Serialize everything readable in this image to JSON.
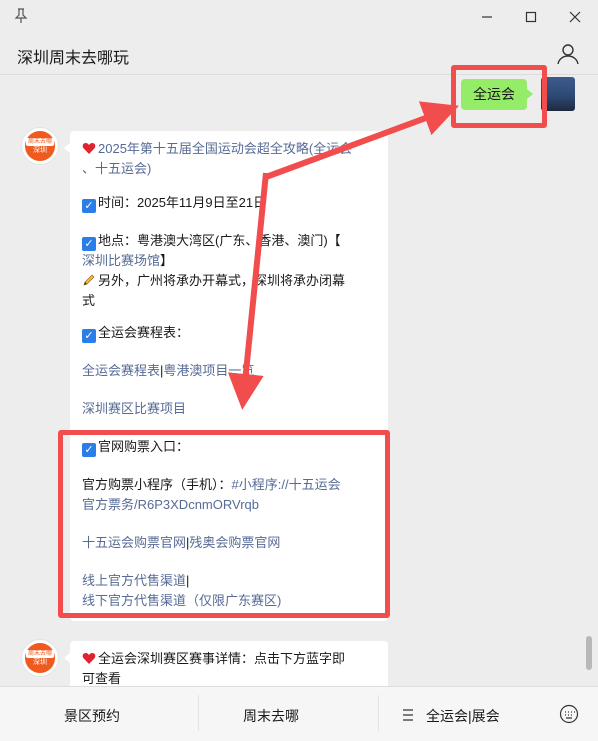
{
  "window": {
    "title": "深圳周末去哪玩"
  },
  "chat": {
    "my_message": "全运会",
    "sender_avatar_tag": "周末去哪",
    "sender_avatar_sub": "深圳",
    "message1": {
      "line1": "2025年第十五届全国运动会超全攻略(全运会",
      "line2": "、十五运会)",
      "time": "时间：2025年11月9日至21日",
      "place_a": "地点：粤港澳大湾区(广东、香港、澳门)【",
      "place_link": "深圳比赛场馆",
      "place_b": "】",
      "note_a": "另外，广州将承办开幕式，深圳将承办闭幕",
      "note_b": "式",
      "schedule_label": "全运会赛程表：",
      "schedule_link1": "全运会赛程表",
      "schedule_sep": "|",
      "schedule_link2": "粤港澳项目一览",
      "shenzhen_link": "深圳赛区比赛项目",
      "ticket_label": "官网购票入口：",
      "mini_a": "官方购票小程序（手机）：",
      "mini_link_a": "#小程序://十五运会",
      "mini_link_b": "官方票务/R6P3XDcnmORVrqb",
      "site_link1": "十五运会购票官网",
      "site_sep": "|",
      "site_link2": "残奥会购票官网",
      "agent_link1": "线上官方代售渠道",
      "agent_sep": "|",
      "agent_link2": "线下官方代售渠道（仅限广东赛区)"
    },
    "message2": {
      "line1": "全运会深圳赛区赛事详情：点击下方蓝字即",
      "line2": "可查看"
    }
  },
  "bottom_menu": {
    "item1": "景区预约",
    "item2": "周末去哪",
    "item3": "全运会|展会"
  },
  "colors": {
    "accent_green": "#95ec69",
    "link": "#576b95",
    "annotation_red": "#f24d4d"
  }
}
